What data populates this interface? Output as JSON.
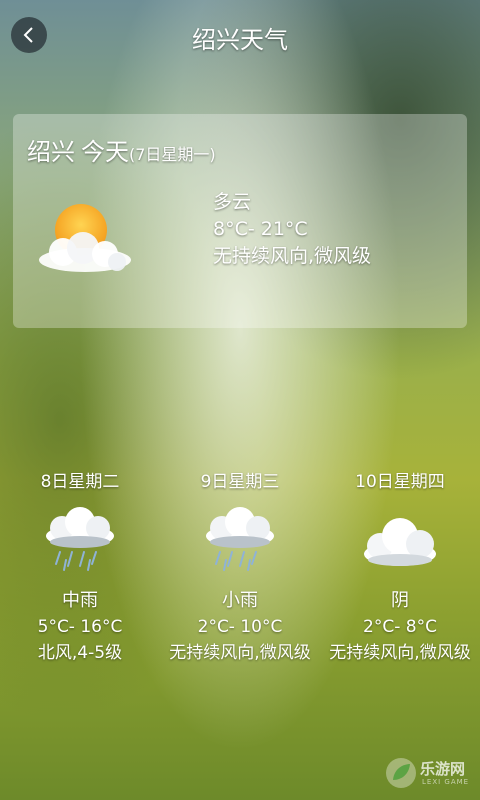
{
  "header": {
    "title": "绍兴天气"
  },
  "today": {
    "city": "绍兴",
    "label": "今天",
    "date": "(7日星期一)",
    "condition": "多云",
    "temperature": "8°C- 21°C",
    "wind": "无持续风向,微风级",
    "icon": "partly-cloudy-sun-icon"
  },
  "forecast": [
    {
      "date": "8日星期二",
      "condition": "中雨",
      "temperature": "5°C- 16°C",
      "wind": "北风,4-5级",
      "icon": "rain-cloud-icon"
    },
    {
      "date": "9日星期三",
      "condition": "小雨",
      "temperature": "2°C- 10°C",
      "wind": "无持续风向,微风级",
      "icon": "rain-cloud-icon"
    },
    {
      "date": "10日星期四",
      "condition": "阴",
      "temperature": "2°C- 8°C",
      "wind": "无持续风向,微风级",
      "icon": "overcast-cloud-icon"
    }
  ],
  "watermark": {
    "logo_text": "乐游网",
    "sub_text": "LEXI GAME"
  },
  "colors": {
    "card_background": "rgba(255,255,255,0.30)",
    "back_button": "#2a3237",
    "text": "#ffffff"
  }
}
